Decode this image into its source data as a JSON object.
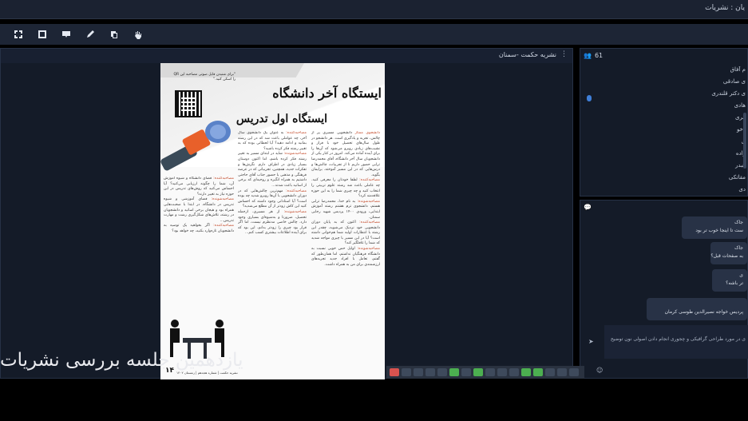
{
  "topbar": {
    "title": "یان : نشریات"
  },
  "toolbar": {
    "tools": [
      {
        "name": "fit-icon"
      },
      {
        "name": "expand-icon"
      },
      {
        "name": "present-icon"
      },
      {
        "name": "pen-icon"
      },
      {
        "name": "copy-icon"
      },
      {
        "name": "hand-icon"
      }
    ]
  },
  "document": {
    "title": "نشریه حکمت -سمنان",
    "more": "⋮",
    "page": {
      "qr_caption": "\"برای شنیدن فایل صوتی مصاحبه این QR را اسکن کنید.\"",
      "headline1": "ایستگاه آخر دانشگاه",
      "headline2": "ایستگاه اول تدریس",
      "page_number": "۱۴",
      "issue": "نشریه حکمت | شماره هجدهم | زمستان ۱۴۰۲"
    }
  },
  "participants": {
    "count": "61",
    "items": [
      "م آفاق",
      "ی صادقی",
      "ی دکتر قلندری",
      "هادی",
      "غری",
      "دخو",
      "ی",
      "زاده",
      "هبدر",
      "مقاتکی",
      "دی"
    ]
  },
  "chat": {
    "messages": [
      {
        "author": "جاک",
        "text": "ست تا اینجا خوب تر بود"
      },
      {
        "author": "جاک",
        "text": "به صفحات قبل؟"
      },
      {
        "author": "ی",
        "text": "تر باشه؟"
      },
      {
        "author": "",
        "text": "پردیس خواجه نصیرالدین طوسی کرمان"
      }
    ],
    "input_text": "ی در مورد طراحی گرافیکی و چجوری انجام دادن اصولی نون توضیح"
  },
  "caption": "یازدهمین جلسه بررسی نشریات"
}
